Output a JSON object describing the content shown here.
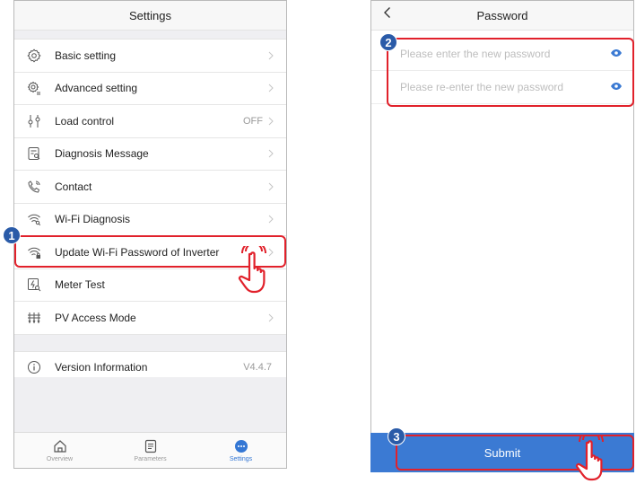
{
  "settings": {
    "title": "Settings",
    "items": [
      {
        "label": "Basic setting",
        "value": "",
        "icon": "gear-icon"
      },
      {
        "label": "Advanced setting",
        "value": "",
        "icon": "advanced-gear-icon"
      },
      {
        "label": "Load control",
        "value": "OFF",
        "icon": "load-control-icon"
      },
      {
        "label": "Diagnosis Message",
        "value": "",
        "icon": "diagnosis-icon"
      },
      {
        "label": "Contact",
        "value": "",
        "icon": "phone-icon"
      },
      {
        "label": "Wi-Fi Diagnosis",
        "value": "",
        "icon": "wifi-search-icon"
      },
      {
        "label": "Update Wi-Fi Password of Inverter",
        "value": "",
        "icon": "wifi-lock-icon"
      },
      {
        "label": "Meter Test",
        "value": "",
        "icon": "meter-icon"
      },
      {
        "label": "PV Access Mode",
        "value": "",
        "icon": "pv-icon"
      }
    ],
    "version": {
      "label": "Version Information",
      "value": "V4.4.7",
      "icon": "info-icon"
    },
    "tabs": [
      {
        "label": "Overview",
        "icon": "home-icon"
      },
      {
        "label": "Parameters",
        "icon": "document-icon"
      },
      {
        "label": "Settings",
        "icon": "more-icon"
      }
    ]
  },
  "password": {
    "title": "Password",
    "back_icon": "back-chevron-icon",
    "fields": [
      {
        "placeholder": "Please enter the new password",
        "icon": "eye-icon"
      },
      {
        "placeholder": "Please re-enter the new password",
        "icon": "eye-icon"
      }
    ],
    "submit_label": "Submit"
  },
  "steps": [
    "1",
    "2",
    "3"
  ],
  "colors": {
    "accent": "#3b7ad3",
    "highlight": "#e1212b",
    "badge": "#2a5ba8"
  }
}
